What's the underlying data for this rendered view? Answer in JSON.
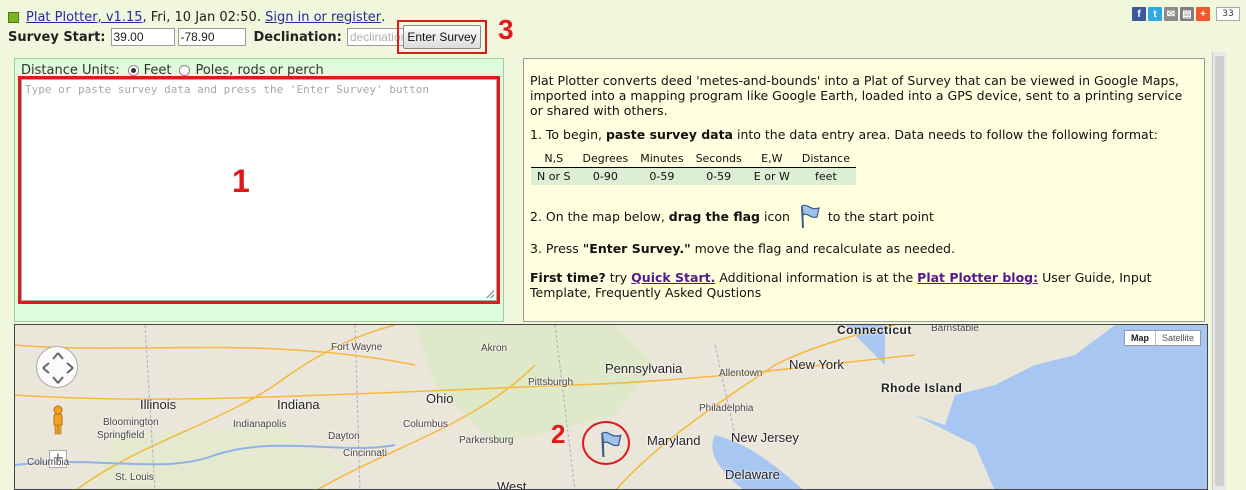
{
  "header": {
    "app_link": "Plat Plotter, v1.15",
    "date_text": ", Fri, 10 Jan 02:50. ",
    "signin_link": "Sign in or register",
    "dot": ".",
    "share_count": "33"
  },
  "toolbar": {
    "survey_start_label": "Survey Start:",
    "lat_value": "39.00",
    "lon_value": "-78.90",
    "declination_label": "Declination:",
    "declination_placeholder": "declination",
    "enter_survey_label": "Enter Survey"
  },
  "annotations": {
    "one": "1",
    "two": "2",
    "three": "3"
  },
  "entry": {
    "units_label": "Distance Units:",
    "feet_label": "Feet",
    "poles_label": "Poles, rods or perch",
    "placeholder": "Type or paste survey data and press the 'Enter Survey' button"
  },
  "info": {
    "intro": "Plat Plotter converts deed 'metes-and-bounds' into a Plat of Survey that can be viewed in Google Maps, imported into a mapping program like Google Earth, loaded into a GPS device, sent to a printing service or shared with others.",
    "step1_pre": "1. To begin, ",
    "step1_bold": "paste survey data",
    "step1_post": " into the data entry area. Data needs to follow the following format:",
    "table": {
      "headers": [
        "N,S",
        "Degrees",
        "Minutes",
        "Seconds",
        "E,W",
        "Distance"
      ],
      "row": [
        "N or S",
        "0-90",
        "0-59",
        "0-59",
        "E or W",
        "feet"
      ]
    },
    "step2_pre": "2. On the map below, ",
    "step2_bold": "drag the flag",
    "step2_mid": " icon",
    "step2_post": "to the start point",
    "step3_pre": "3. Press ",
    "step3_bold": "\"Enter Survey.\"",
    "step3_post": " move the flag and recalculate as needed.",
    "first_bold": "First time?",
    "first_try": " try ",
    "quick_start": "Quick Start.",
    "additional": " Additional information is at the ",
    "blog_link": "Plat Plotter blog:",
    "guides": " User Guide, Input Template, Frequently Asked Qustions"
  },
  "map": {
    "map_button": "Map",
    "satellite_button": "Satellite",
    "zoom_in": "+",
    "states": [
      "Illinois",
      "Indiana",
      "Ohio",
      "Pennsylvania",
      "Maryland",
      "New Jersey",
      "Delaware",
      "Rhode Island",
      "Connecticut",
      "New York",
      "West"
    ],
    "cities": [
      "Fort Wayne",
      "Akron",
      "Barnstable",
      "Pittsburgh",
      "Allentown",
      "Bloomington",
      "Springfield",
      "Indianapolis",
      "Columbus",
      "Philadelphia",
      "Dayton",
      "Parkersburg",
      "Cincinnati",
      "Columbia",
      "St. Louis"
    ]
  },
  "colors": {
    "accent_red": "#e0191b",
    "entry_bg": "#defbdc",
    "info_bg": "#ffffdf",
    "page_bg": "#f0f7dc"
  }
}
